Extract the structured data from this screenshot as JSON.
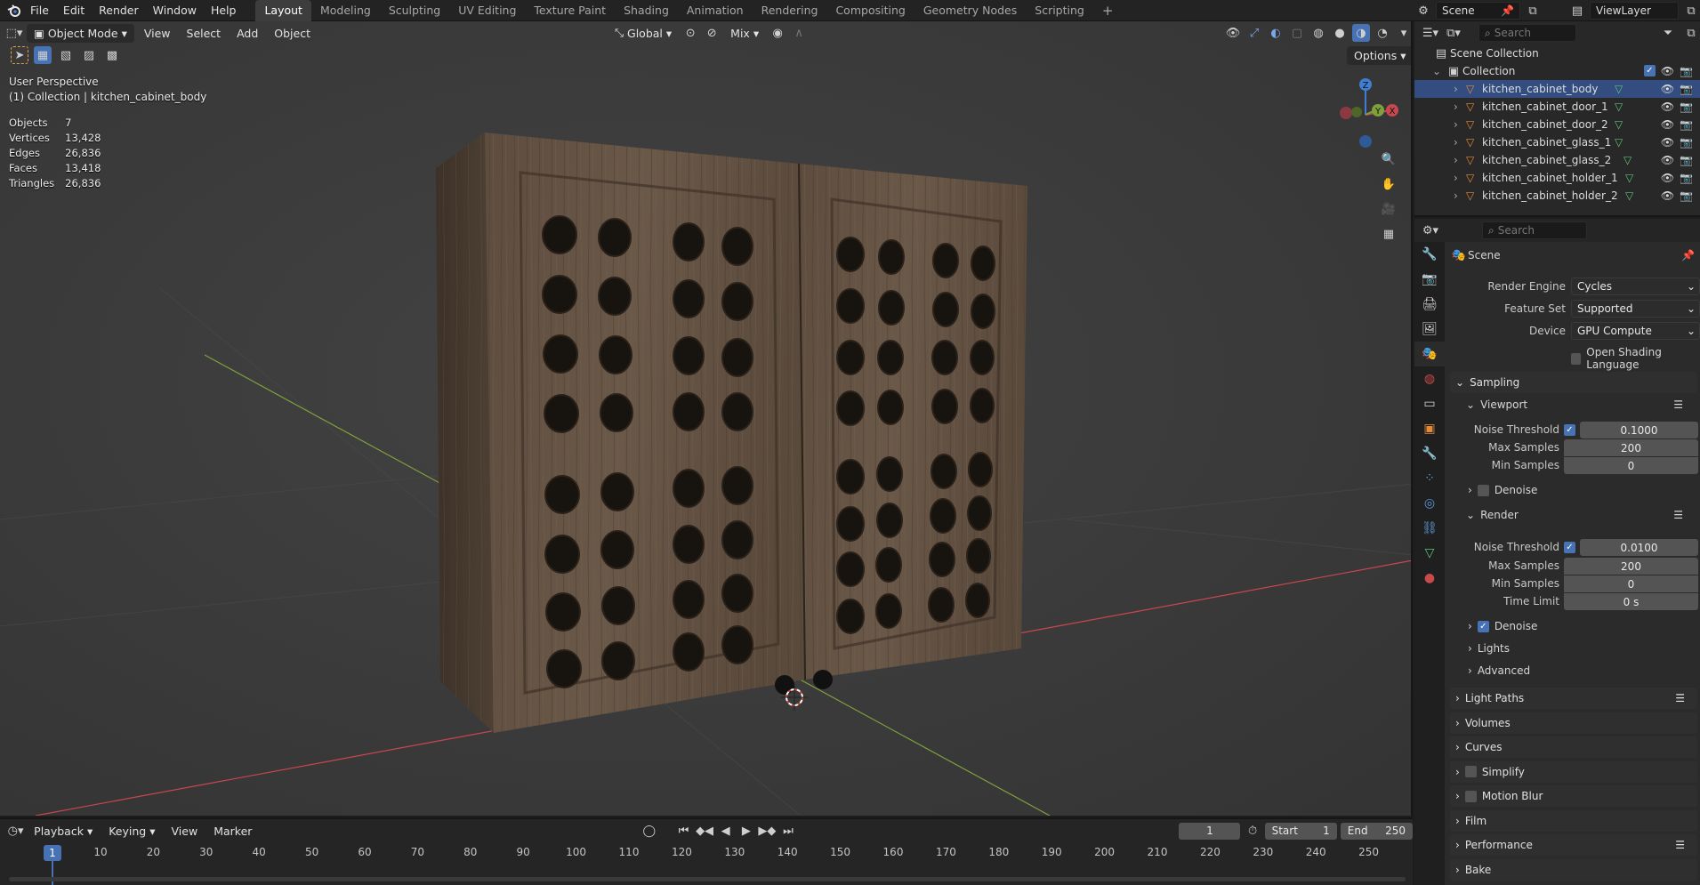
{
  "topbar": {
    "menus": [
      "File",
      "Edit",
      "Render",
      "Window",
      "Help"
    ],
    "workspaces": [
      "Layout",
      "Modeling",
      "Sculpting",
      "UV Editing",
      "Texture Paint",
      "Shading",
      "Animation",
      "Rendering",
      "Compositing",
      "Geometry Nodes",
      "Scripting"
    ],
    "active_workspace": "Layout",
    "add_tab": "+",
    "scene": "Scene",
    "view_layer": "ViewLayer"
  },
  "viewport": {
    "mode": "Object Mode",
    "menus": [
      "View",
      "Select",
      "Add",
      "Object"
    ],
    "transform": "Global",
    "snap_mode": "Mix",
    "options": "Options",
    "perspective": "User Perspective",
    "collection_line": "(1) Collection | kitchen_cabinet_body",
    "stats": [
      {
        "label": "Objects",
        "value": "7"
      },
      {
        "label": "Vertices",
        "value": "13,428"
      },
      {
        "label": "Edges",
        "value": "26,836"
      },
      {
        "label": "Faces",
        "value": "13,418"
      },
      {
        "label": "Triangles",
        "value": "26,836"
      }
    ],
    "gizmo": {
      "z": "Z",
      "y": "Y",
      "x": "X"
    },
    "colors": {
      "wood": "#5a4a3c",
      "x_axis": "#c9474f",
      "y_axis": "#7ea13a",
      "z_axis": "#3f7ed0"
    }
  },
  "outliner": {
    "search_placeholder": "Search",
    "scene_collection": "Scene Collection",
    "collection": "Collection",
    "items": [
      "kitchen_cabinet_body",
      "kitchen_cabinet_door_1",
      "kitchen_cabinet_door_2",
      "kitchen_cabinet_glass_1",
      "kitchen_cabinet_glass_2",
      "kitchen_cabinet_holder_1",
      "kitchen_cabinet_holder_2"
    ]
  },
  "properties": {
    "search_placeholder": "Search",
    "context": "Scene",
    "render_engine_label": "Render Engine",
    "render_engine": "Cycles",
    "feature_set_label": "Feature Set",
    "feature_set": "Supported",
    "device_label": "Device",
    "device": "GPU Compute",
    "osl": "Open Shading Language",
    "sampling": "Sampling",
    "viewport_sub": "Viewport",
    "noise_threshold_label": "Noise Threshold",
    "max_samples_label": "Max Samples",
    "min_samples_label": "Min Samples",
    "time_limit_label": "Time Limit",
    "vp_noise": "0.1000",
    "vp_max": "200",
    "vp_min": "0",
    "denoise": "Denoise",
    "render_sub": "Render",
    "r_noise": "0.0100",
    "r_max": "200",
    "r_min": "0",
    "r_time": "0 s",
    "lights": "Lights",
    "advanced": "Advanced",
    "panels": [
      "Light Paths",
      "Volumes",
      "Curves",
      "Simplify",
      "Motion Blur",
      "Film",
      "Performance",
      "Bake"
    ]
  },
  "timeline": {
    "menus": [
      "Playback",
      "Keying",
      "View",
      "Marker"
    ],
    "current_frame": "1",
    "start_label": "Start",
    "start": "1",
    "end_label": "End",
    "end": "250",
    "ticks": [
      "10",
      "20",
      "30",
      "40",
      "50",
      "60",
      "70",
      "80",
      "90",
      "100",
      "110",
      "120",
      "130",
      "140",
      "150",
      "160",
      "170",
      "180",
      "190",
      "200",
      "210",
      "220",
      "230",
      "240",
      "250"
    ]
  }
}
